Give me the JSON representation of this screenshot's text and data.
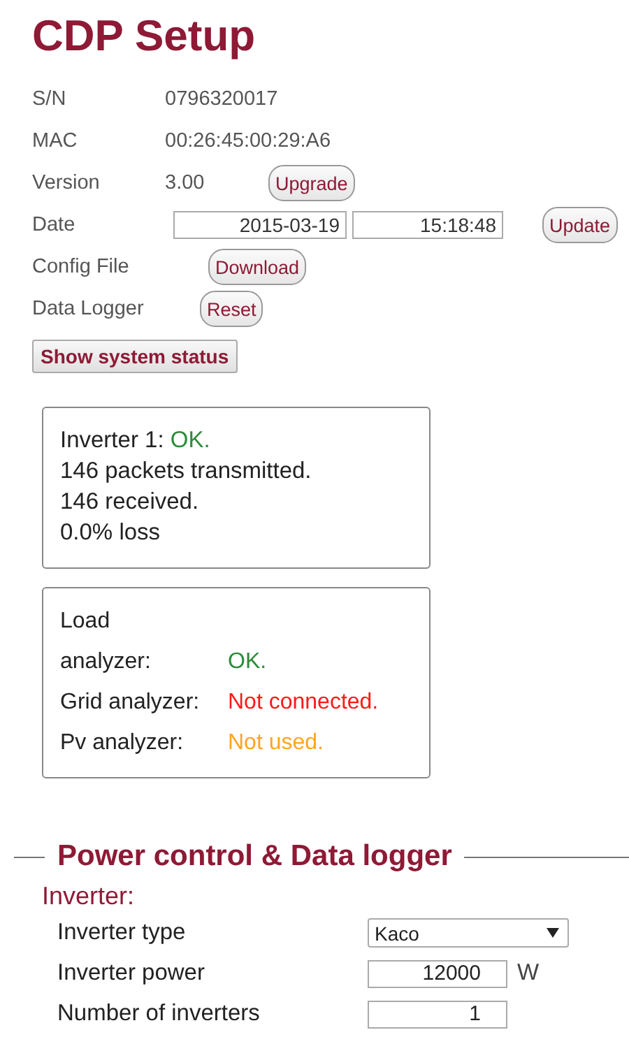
{
  "title": "CDP Setup",
  "info": [
    {
      "label": "S/N",
      "value": "0796320017"
    },
    {
      "label": "MAC",
      "value": "00:26:45:00:29:A6"
    },
    {
      "label": "Version",
      "value": "3.00",
      "button": "Upgrade"
    }
  ],
  "date": {
    "label": "Date",
    "date": "2015-03-19",
    "time": "15:18:48",
    "button": "Update"
  },
  "actions": [
    {
      "label": "Config File",
      "button": "Download"
    },
    {
      "label": "Data Logger",
      "button": "Reset"
    }
  ],
  "status_button": "Show system status",
  "inverter_status": {
    "label": "Inverter 1:",
    "status": "OK.",
    "color": "#2e8b3a",
    "lines": [
      "146 packets transmitted.",
      "146 received.",
      "0.0% loss"
    ]
  },
  "analyzers": [
    {
      "label": "Load analyzer:",
      "status": "OK.",
      "color": "#2e8b3a"
    },
    {
      "label": "Grid analyzer:",
      "status": "Not connected.",
      "color": "#ff1a1a"
    },
    {
      "label": "Pv analyzer:",
      "status": "Not used.",
      "color": "#ffa520"
    }
  ],
  "section": {
    "legend": "Power control & Data logger",
    "subheading": "Inverter:",
    "fields": [
      {
        "kind": "select",
        "label": "Inverter type",
        "value": "Kaco"
      },
      {
        "kind": "number",
        "label": "Inverter power",
        "value": "12000",
        "unit": "W"
      },
      {
        "kind": "number",
        "label": "Number of inverters",
        "value": "1"
      }
    ]
  }
}
